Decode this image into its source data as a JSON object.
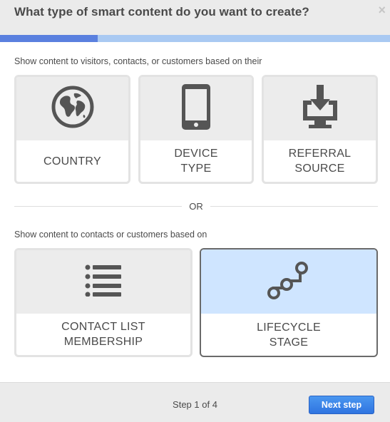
{
  "dialog": {
    "title": "What type of smart content do you want to create?",
    "close_glyph": "×",
    "progress_fraction": 0.25
  },
  "section1": {
    "label": "Show content to visitors, contacts, or customers based on their",
    "cards": [
      {
        "label": "COUNTRY",
        "icon": "globe-icon"
      },
      {
        "label": "DEVICE\nTYPE",
        "icon": "mobile-device-icon"
      },
      {
        "label": "REFERRAL\nSOURCE",
        "icon": "download-to-monitor-icon"
      }
    ]
  },
  "or_label": "OR",
  "section2": {
    "label": "Show content to contacts or customers based on",
    "cards": [
      {
        "label": "CONTACT LIST\nMEMBERSHIP",
        "icon": "list-icon"
      },
      {
        "label": "LIFECYCLE\nSTAGE",
        "icon": "lifecycle-icon",
        "selected": true
      }
    ]
  },
  "footer": {
    "step_text": "Step 1 of 4",
    "next_label": "Next step"
  },
  "colors": {
    "accent": "#5a80df",
    "progress_track": "#a9c9f2",
    "selected_card": "#cfe5ff",
    "button": "#3a84e8"
  }
}
